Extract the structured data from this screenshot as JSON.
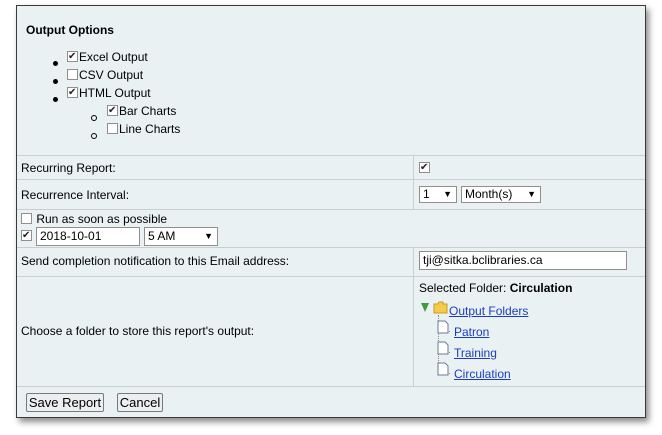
{
  "output_options": {
    "title": "Output Options",
    "excel_label": "Excel Output",
    "excel_checked": true,
    "csv_label": "CSV Output",
    "csv_checked": false,
    "html_label": "HTML Output",
    "html_checked": true,
    "bar_charts_label": "Bar Charts",
    "bar_charts_checked": true,
    "line_charts_label": "Line Charts",
    "line_charts_checked": false
  },
  "recurring": {
    "label": "Recurring Report:",
    "checked": true
  },
  "interval": {
    "label": "Recurrence Interval:",
    "count": "1",
    "unit": "Month(s)"
  },
  "schedule": {
    "run_asap_label": "Run as soon as possible",
    "run_asap_checked": false,
    "date_checked": true,
    "date_value": "2018-10-01",
    "time_value": "5 AM"
  },
  "email": {
    "label": "Send completion notification to this Email address:",
    "value": "tji@sitka.bclibraries.ca"
  },
  "folder": {
    "label": "Choose a folder to store this report's output:",
    "selected_prefix": "Selected Folder:",
    "selected_name": "Circulation",
    "root": "Output Folders",
    "children": [
      "Patron",
      "Training",
      "Circulation"
    ]
  },
  "actions": {
    "save_label": "Save Report",
    "cancel_label": "Cancel"
  }
}
